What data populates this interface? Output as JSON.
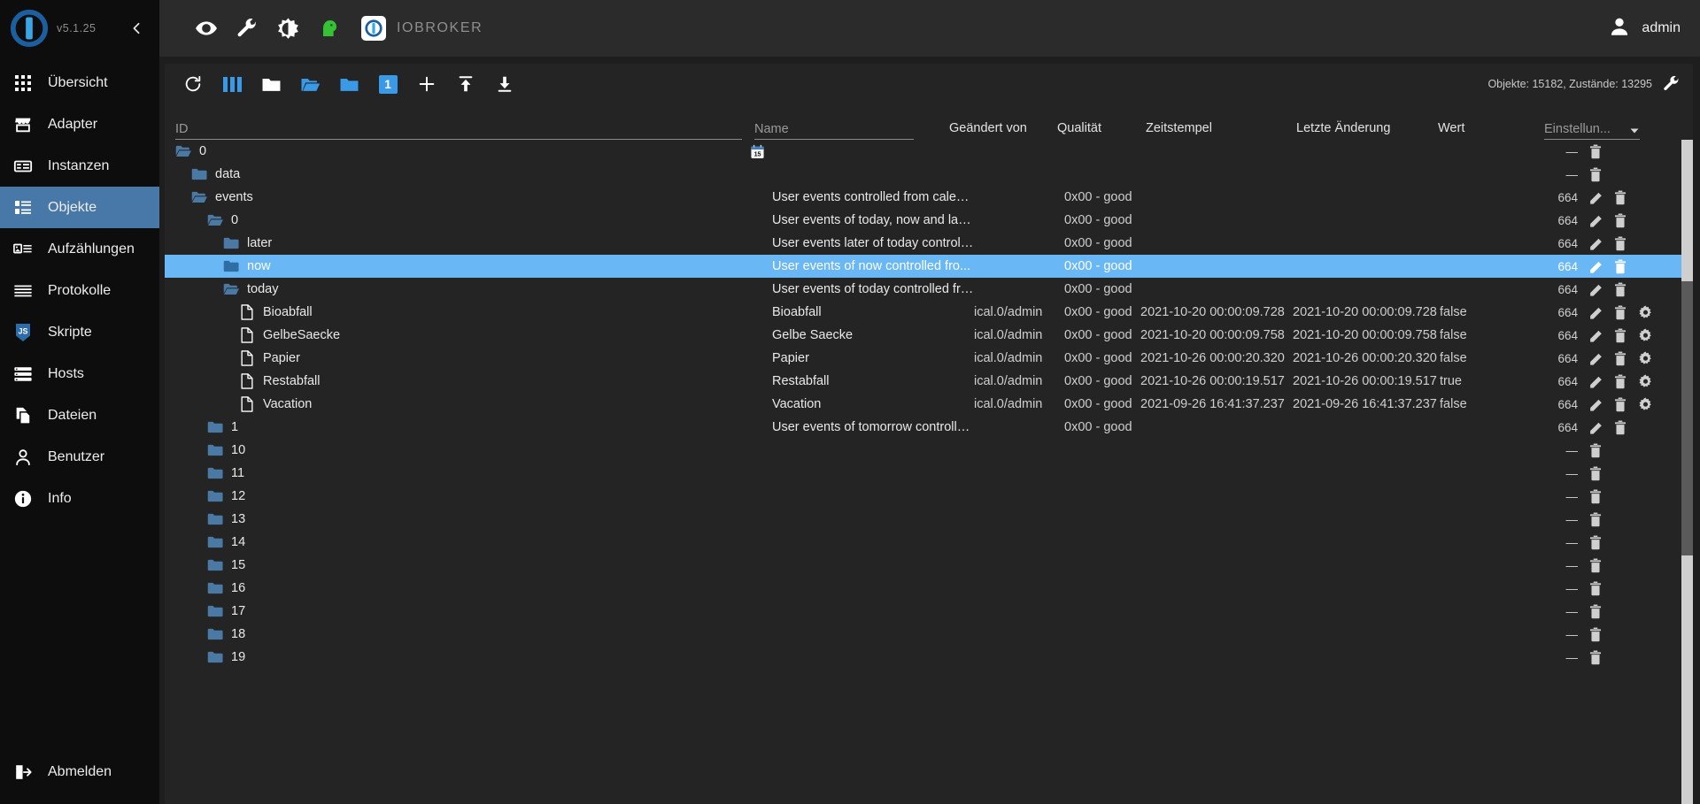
{
  "sidebar": {
    "version": "v5.1.25",
    "collapse_icon": "chevron-left-icon",
    "items": [
      {
        "label": "Übersicht",
        "icon": "grid-apps-icon",
        "active": false
      },
      {
        "label": "Adapter",
        "icon": "store-icon",
        "active": false
      },
      {
        "label": "Instanzen",
        "icon": "server-rows-icon",
        "active": false
      },
      {
        "label": "Objekte",
        "icon": "list-objects-icon",
        "active": true
      },
      {
        "label": "Aufzählungen",
        "icon": "enum-list-icon",
        "active": false
      },
      {
        "label": "Protokolle",
        "icon": "log-lines-icon",
        "active": false
      },
      {
        "label": "Skripte",
        "icon": "js-badge-icon",
        "active": false
      },
      {
        "label": "Hosts",
        "icon": "hosts-stack-icon",
        "active": false
      },
      {
        "label": "Dateien",
        "icon": "files-copy-icon",
        "active": false
      },
      {
        "label": "Benutzer",
        "icon": "person-icon",
        "active": false
      },
      {
        "label": "Info",
        "icon": "info-circle-icon",
        "active": false
      }
    ],
    "logout": {
      "label": "Abmelden",
      "icon": "logout-icon"
    }
  },
  "topbar": {
    "icons": [
      {
        "name": "eye-icon"
      },
      {
        "name": "wrench-icon"
      },
      {
        "name": "brightness-contrast-icon"
      },
      {
        "name": "green-head-icon"
      }
    ],
    "brand_icon": "iobroker-logo-icon",
    "brand": "IOBROKER",
    "user": "admin",
    "user_icon": "account-avatar-icon"
  },
  "toolbar": {
    "buttons": [
      {
        "name": "refresh-icon",
        "label": "Aktualisieren"
      },
      {
        "name": "columns-expand-icon",
        "label": "Spalten"
      },
      {
        "name": "collapse-all-icon",
        "label": "Alle zuklappen"
      },
      {
        "name": "expand-all-icon",
        "label": "Alle aufklappen"
      },
      {
        "name": "expand-one-icon",
        "label": "Eine Ebene aufklappen"
      },
      {
        "name": "depth-one-icon",
        "label": "1"
      },
      {
        "name": "add-object-icon",
        "label": "Hinzufügen"
      },
      {
        "name": "import-icon",
        "label": "Importieren"
      },
      {
        "name": "export-icon",
        "label": "Exportieren"
      }
    ],
    "depth_badge": "1",
    "counts": "Objekte: 15182, Zustände: 13295",
    "settings_icon": "wrench-settings-icon"
  },
  "table": {
    "columns": {
      "id": "ID",
      "name": "Name",
      "changed_by": "Geändert von",
      "quality": "Qualität",
      "timestamp": "Zeitstempel",
      "lastchange": "Letzte Änderung",
      "value": "Wert",
      "settings": "Einstellun..."
    },
    "filter_id_value": "",
    "filter_name_value": "",
    "settings_caret": "chevron-down-icon",
    "rows": [
      {
        "id": "0",
        "depth": 0,
        "kind": "folder-open",
        "name": "",
        "changed_by": "",
        "quality": "",
        "timestamp": "",
        "lastchange": "",
        "value": "",
        "perm": "—",
        "icons": [
          "delete"
        ],
        "badge": "calendar-15-icon",
        "selected": false
      },
      {
        "id": "data",
        "depth": 1,
        "kind": "folder-closed",
        "name": "",
        "changed_by": "",
        "quality": "",
        "timestamp": "",
        "lastchange": "",
        "value": "",
        "perm": "—",
        "icons": [
          "delete"
        ],
        "badge": "",
        "selected": false
      },
      {
        "id": "events",
        "depth": 1,
        "kind": "folder-open",
        "name": "User events controlled from calendar",
        "changed_by": "",
        "quality": "0x00 - good",
        "timestamp": "",
        "lastchange": "",
        "value": "",
        "perm": "664",
        "icons": [
          "edit",
          "delete"
        ],
        "badge": "",
        "selected": false
      },
      {
        "id": "0",
        "depth": 2,
        "kind": "folder-open",
        "name": "User events of today, now and late...",
        "changed_by": "",
        "quality": "0x00 - good",
        "timestamp": "",
        "lastchange": "",
        "value": "",
        "perm": "664",
        "icons": [
          "edit",
          "delete"
        ],
        "badge": "",
        "selected": false
      },
      {
        "id": "later",
        "depth": 3,
        "kind": "folder-closed",
        "name": "User events later of today controlle...",
        "changed_by": "",
        "quality": "0x00 - good",
        "timestamp": "",
        "lastchange": "",
        "value": "",
        "perm": "664",
        "icons": [
          "edit",
          "delete"
        ],
        "badge": "",
        "selected": false
      },
      {
        "id": "now",
        "depth": 3,
        "kind": "folder-closed",
        "name": "User events of now controlled fro...",
        "changed_by": "",
        "quality": "0x00 - good",
        "timestamp": "",
        "lastchange": "",
        "value": "",
        "perm": "664",
        "icons": [
          "edit",
          "delete"
        ],
        "badge": "",
        "selected": true
      },
      {
        "id": "today",
        "depth": 3,
        "kind": "folder-open",
        "name": "User events of today controlled fro...",
        "changed_by": "",
        "quality": "0x00 - good",
        "timestamp": "",
        "lastchange": "",
        "value": "",
        "perm": "664",
        "icons": [
          "edit",
          "delete"
        ],
        "badge": "",
        "selected": false
      },
      {
        "id": "Bioabfall",
        "depth": 4,
        "kind": "state",
        "name": "Bioabfall",
        "changed_by": "ical.0/admin",
        "quality": "0x00 - good",
        "timestamp": "2021-10-20 00:00:09.728",
        "lastchange": "2021-10-20 00:00:09.728",
        "value": "false",
        "perm": "664",
        "icons": [
          "edit",
          "delete",
          "settings"
        ],
        "badge": "",
        "selected": false
      },
      {
        "id": "GelbeSaecke",
        "depth": 4,
        "kind": "state",
        "name": "Gelbe Saecke",
        "changed_by": "ical.0/admin",
        "quality": "0x00 - good",
        "timestamp": "2021-10-20 00:00:09.758",
        "lastchange": "2021-10-20 00:00:09.758",
        "value": "false",
        "perm": "664",
        "icons": [
          "edit",
          "delete",
          "settings"
        ],
        "badge": "",
        "selected": false
      },
      {
        "id": "Papier",
        "depth": 4,
        "kind": "state",
        "name": "Papier",
        "changed_by": "ical.0/admin",
        "quality": "0x00 - good",
        "timestamp": "2021-10-26 00:00:20.320",
        "lastchange": "2021-10-26 00:00:20.320",
        "value": "false",
        "perm": "664",
        "icons": [
          "edit",
          "delete",
          "settings"
        ],
        "badge": "",
        "selected": false
      },
      {
        "id": "Restabfall",
        "depth": 4,
        "kind": "state",
        "name": "Restabfall",
        "changed_by": "ical.0/admin",
        "quality": "0x00 - good",
        "timestamp": "2021-10-26 00:00:19.517",
        "lastchange": "2021-10-26 00:00:19.517",
        "value": "true",
        "perm": "664",
        "icons": [
          "edit",
          "delete",
          "settings"
        ],
        "badge": "",
        "selected": false
      },
      {
        "id": "Vacation",
        "depth": 4,
        "kind": "state",
        "name": "Vacation",
        "changed_by": "ical.0/admin",
        "quality": "0x00 - good",
        "timestamp": "2021-09-26 16:41:37.237",
        "lastchange": "2021-09-26 16:41:37.237",
        "value": "false",
        "perm": "664",
        "icons": [
          "edit",
          "delete",
          "settings"
        ],
        "badge": "",
        "selected": false
      },
      {
        "id": "1",
        "depth": 2,
        "kind": "folder-closed",
        "name": "User events of tomorrow controlle...",
        "changed_by": "",
        "quality": "0x00 - good",
        "timestamp": "",
        "lastchange": "",
        "value": "",
        "perm": "664",
        "icons": [
          "edit",
          "delete"
        ],
        "badge": "",
        "selected": false
      },
      {
        "id": "10",
        "depth": 2,
        "kind": "folder-closed",
        "name": "",
        "changed_by": "",
        "quality": "",
        "timestamp": "",
        "lastchange": "",
        "value": "",
        "perm": "—",
        "icons": [
          "delete"
        ],
        "badge": "",
        "selected": false
      },
      {
        "id": "11",
        "depth": 2,
        "kind": "folder-closed",
        "name": "",
        "changed_by": "",
        "quality": "",
        "timestamp": "",
        "lastchange": "",
        "value": "",
        "perm": "—",
        "icons": [
          "delete"
        ],
        "badge": "",
        "selected": false
      },
      {
        "id": "12",
        "depth": 2,
        "kind": "folder-closed",
        "name": "",
        "changed_by": "",
        "quality": "",
        "timestamp": "",
        "lastchange": "",
        "value": "",
        "perm": "—",
        "icons": [
          "delete"
        ],
        "badge": "",
        "selected": false
      },
      {
        "id": "13",
        "depth": 2,
        "kind": "folder-closed",
        "name": "",
        "changed_by": "",
        "quality": "",
        "timestamp": "",
        "lastchange": "",
        "value": "",
        "perm": "—",
        "icons": [
          "delete"
        ],
        "badge": "",
        "selected": false
      },
      {
        "id": "14",
        "depth": 2,
        "kind": "folder-closed",
        "name": "",
        "changed_by": "",
        "quality": "",
        "timestamp": "",
        "lastchange": "",
        "value": "",
        "perm": "—",
        "icons": [
          "delete"
        ],
        "badge": "",
        "selected": false
      },
      {
        "id": "15",
        "depth": 2,
        "kind": "folder-closed",
        "name": "",
        "changed_by": "",
        "quality": "",
        "timestamp": "",
        "lastchange": "",
        "value": "",
        "perm": "—",
        "icons": [
          "delete"
        ],
        "badge": "",
        "selected": false
      },
      {
        "id": "16",
        "depth": 2,
        "kind": "folder-closed",
        "name": "",
        "changed_by": "",
        "quality": "",
        "timestamp": "",
        "lastchange": "",
        "value": "",
        "perm": "—",
        "icons": [
          "delete"
        ],
        "badge": "",
        "selected": false
      },
      {
        "id": "17",
        "depth": 2,
        "kind": "folder-closed",
        "name": "",
        "changed_by": "",
        "quality": "",
        "timestamp": "",
        "lastchange": "",
        "value": "",
        "perm": "—",
        "icons": [
          "delete"
        ],
        "badge": "",
        "selected": false
      },
      {
        "id": "18",
        "depth": 2,
        "kind": "folder-closed",
        "name": "",
        "changed_by": "",
        "quality": "",
        "timestamp": "",
        "lastchange": "",
        "value": "",
        "perm": "—",
        "icons": [
          "delete"
        ],
        "badge": "",
        "selected": false
      },
      {
        "id": "19",
        "depth": 2,
        "kind": "folder-closed",
        "name": "",
        "changed_by": "",
        "quality": "",
        "timestamp": "",
        "lastchange": "",
        "value": "",
        "perm": "—",
        "icons": [
          "delete"
        ],
        "badge": "",
        "selected": false
      }
    ]
  },
  "colors": {
    "accent": "#3a8fd9",
    "selection": "#6ab7f5",
    "sidebar_bg": "#0d0d0d",
    "panel_bg": "#242424",
    "topbar_bg": "#2b2b2b",
    "folder_blue": "#4a79a4",
    "folder_light": "#5ba7e8"
  }
}
